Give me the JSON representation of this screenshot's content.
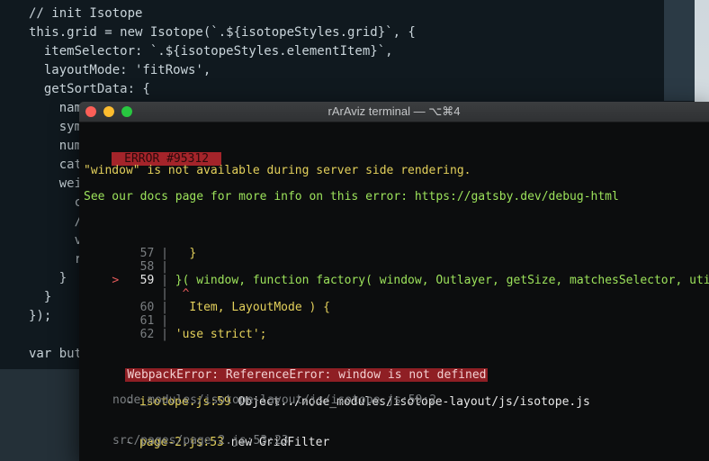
{
  "editor": {
    "lines": [
      {
        "text": "// init Isotope",
        "indent": 0
      },
      {
        "text": "this.grid = new Isotope(`.${isotopeStyles.grid}`, {",
        "indent": 0
      },
      {
        "text": "  itemSelector: `.${isotopeStyles.elementItem}`,",
        "indent": 0
      },
      {
        "text": "  layoutMode: 'fitRows',",
        "indent": 0
      },
      {
        "text": "  getSortData: {",
        "indent": 0
      },
      {
        "text": "    nam",
        "indent": 0
      },
      {
        "text": "    sym",
        "indent": 0
      },
      {
        "text": "    num",
        "indent": 0
      },
      {
        "text": "    cat",
        "indent": 0
      },
      {
        "text": "    wei",
        "indent": 0
      },
      {
        "text": "      c",
        "indent": 0
      },
      {
        "text": "      /",
        "indent": 0
      },
      {
        "text": "      v",
        "indent": 0
      },
      {
        "text": "      r",
        "indent": 0
      },
      {
        "text": "    }",
        "indent": 0
      },
      {
        "text": "  }",
        "indent": 0
      },
      {
        "text": "});",
        "indent": 0
      },
      {
        "text": "",
        "indent": 0
      },
      {
        "text": "var but",
        "indent": 0
      }
    ]
  },
  "terminal": {
    "title": "rArAviz terminal — ⌥⌘4",
    "error_code": " ERROR #95312 ",
    "message": "\"window\" is not available during server side rendering.",
    "docs_line": "See our docs page for more info on this error: https://gatsby.dev/debug-html",
    "code_frame": [
      {
        "marker": "  ",
        "num": "57",
        "sep": " | ",
        "code": "  }"
      },
      {
        "marker": "  ",
        "num": "58",
        "sep": " |",
        "code": ""
      },
      {
        "marker": "> ",
        "num": "59",
        "sep": " | ",
        "code": "}( window, function factory( window, Outlayer, getSize, matchesSelector, utils,"
      },
      {
        "marker": "  ",
        "num": "  ",
        "sep": " | ",
        "code": " ^"
      },
      {
        "marker": "  ",
        "num": "60",
        "sep": " | ",
        "code": "  Item, LayoutMode ) {"
      },
      {
        "marker": "  ",
        "num": "61",
        "sep": " |",
        "code": ""
      },
      {
        "marker": "  ",
        "num": "62",
        "sep": " | ",
        "code": "'use strict';"
      }
    ],
    "webpack_error": "WebpackError: ReferenceError: window is not defined",
    "stack": [
      {
        "dash": "- ",
        "file": "isotope.js:59",
        "desc": " Object../node_modules/isotope-layout/js/isotope.js",
        "path": "node_modules/isotope-layout/js/isotope.js:59:2"
      },
      {
        "dash": "- ",
        "file": "page-2.js:53",
        "desc": " new GridFilter",
        "path": "src/pages/page-2.js:53:23"
      }
    ]
  }
}
